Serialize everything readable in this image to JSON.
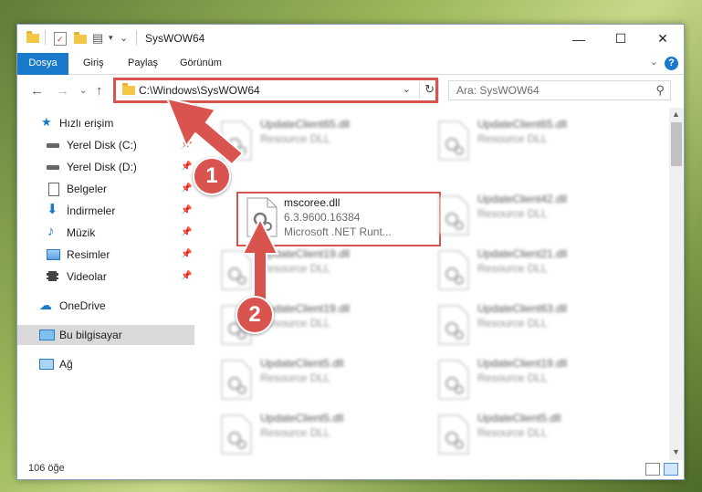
{
  "window": {
    "title": "SysWOW64"
  },
  "ribbon": {
    "tabs": [
      "Dosya",
      "Giriş",
      "Paylaş",
      "Görünüm"
    ]
  },
  "address": {
    "path": "C:\\Windows\\SysWOW64"
  },
  "search": {
    "placeholder": "Ara: SysWOW64"
  },
  "sidebar": {
    "quick_access": "Hızlı erişim",
    "items": [
      {
        "label": "Yerel Disk (C:)",
        "icon": "drive-icon"
      },
      {
        "label": "Yerel Disk (D:)",
        "icon": "drive-icon"
      },
      {
        "label": "Belgeler",
        "icon": "documents-icon"
      },
      {
        "label": "İndirmeler",
        "icon": "download-icon"
      },
      {
        "label": "Müzik",
        "icon": "music-icon"
      },
      {
        "label": "Resimler",
        "icon": "pictures-icon"
      },
      {
        "label": "Videolar",
        "icon": "videos-icon"
      }
    ],
    "onedrive": "OneDrive",
    "this_pc": "Bu bilgisayar",
    "network": "Ağ"
  },
  "files": {
    "left": [
      {
        "name": "UpdateClient65.dll",
        "desc": "Resource DLL"
      },
      {
        "name": "mscoree.dll",
        "desc": "6.3.9600.16384",
        "desc2": "Microsoft .NET Runt..."
      },
      {
        "name": "UpdateClient19.dll",
        "desc": "Resource DLL"
      },
      {
        "name": "UpdateClient19.dll",
        "desc": "Resource DLL"
      },
      {
        "name": "UpdateClient5.dll",
        "desc": "Resource DLL"
      },
      {
        "name": "UpdateClient5.dll",
        "desc": "Resource DLL"
      }
    ],
    "right": [
      {
        "name": "UpdateClient65.dll",
        "desc": "Resource DLL"
      },
      {
        "name": "UpdateClient42.dll",
        "desc": "Resource DLL"
      },
      {
        "name": "UpdateClient21.dll",
        "desc": "Resource DLL"
      },
      {
        "name": "UpdateClient63.dll",
        "desc": "Resource DLL"
      },
      {
        "name": "UpdateClient19.dll",
        "desc": "Resource DLL"
      },
      {
        "name": "UpdateClient5.dll",
        "desc": "Resource DLL"
      }
    ]
  },
  "status": {
    "count": "106 öğe"
  },
  "annotations": {
    "step1": "1",
    "step2": "2",
    "accent": "#d9534f"
  }
}
